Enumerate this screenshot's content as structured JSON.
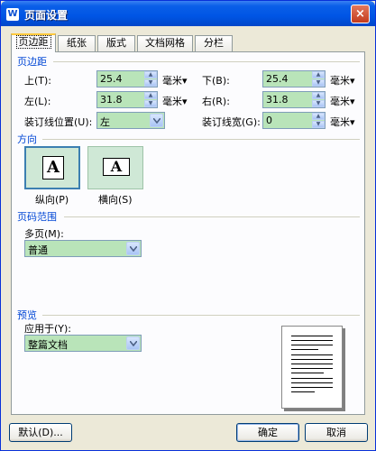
{
  "window": {
    "title": "页面设置",
    "app_icon": "W",
    "close": "×"
  },
  "tabs": [
    {
      "label": "页边距",
      "active": true
    },
    {
      "label": "纸张",
      "active": false
    },
    {
      "label": "版式",
      "active": false
    },
    {
      "label": "文档网格",
      "active": false
    },
    {
      "label": "分栏",
      "active": false
    }
  ],
  "margins": {
    "group_title": "页边距",
    "top": {
      "label": "上(T):",
      "value": "25.4",
      "unit": "毫米▾"
    },
    "bottom": {
      "label": "下(B):",
      "value": "25.4",
      "unit": "毫米▾"
    },
    "left": {
      "label": "左(L):",
      "value": "31.8",
      "unit": "毫米▾"
    },
    "right": {
      "label": "右(R):",
      "value": "31.8",
      "unit": "毫米▾"
    },
    "gutter_pos": {
      "label": "装订线位置(U):",
      "value": "左"
    },
    "gutter_width": {
      "label": "装订线宽(G):",
      "value": "0",
      "unit": "毫米▾"
    }
  },
  "orientation": {
    "group_title": "方向",
    "portrait": {
      "label": "纵向(P)",
      "glyph": "A",
      "selected": true
    },
    "landscape": {
      "label": "横向(S)",
      "glyph": "A",
      "selected": false
    }
  },
  "page_range": {
    "group_title": "页码范围",
    "multi_label": "多页(M):",
    "multi_value": "普通"
  },
  "preview": {
    "group_title": "预览",
    "apply_label": "应用于(Y):",
    "apply_value": "整篇文档"
  },
  "buttons": {
    "default": "默认(D)...",
    "ok": "确定",
    "cancel": "取消"
  },
  "colors": {
    "titlebar": "#0055e5",
    "field_bg": "#b9e4b9",
    "group_title": "#0046d5"
  }
}
